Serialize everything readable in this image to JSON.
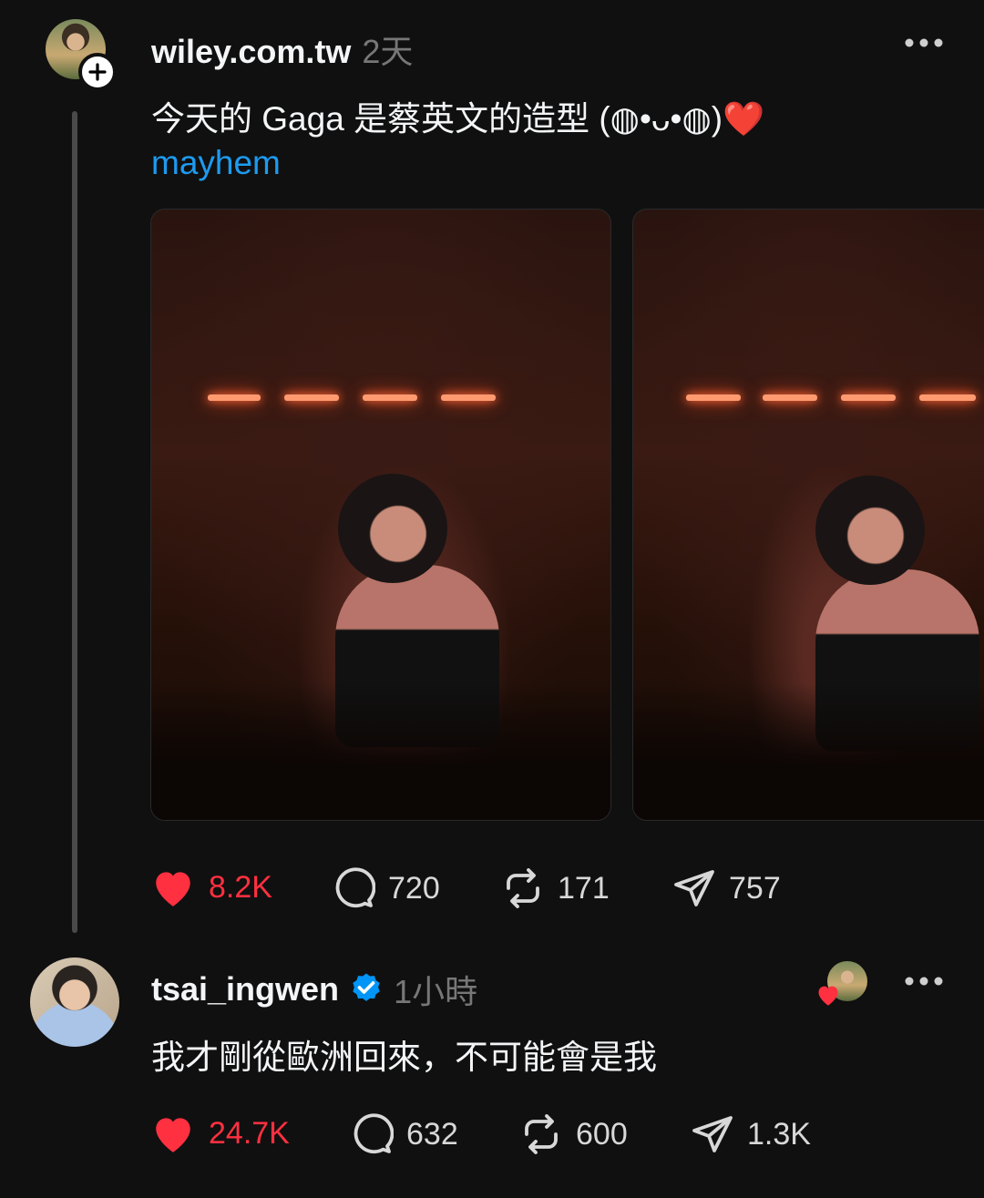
{
  "post1": {
    "username": "wiley.com.tw",
    "time": "2天",
    "text": "今天的 Gaga 是蔡英文的造型 (◍•ᴗ•◍)❤️",
    "tag": "mayhem",
    "actions": {
      "likes": "8.2K",
      "replies": "720",
      "reposts": "171",
      "shares": "757"
    }
  },
  "post2": {
    "username": "tsai_ingwen",
    "time": "1小時",
    "text": "我才剛從歐洲回來，不可能會是我",
    "actions": {
      "likes": "24.7K",
      "replies": "632",
      "reposts": "600",
      "shares": "1.3K"
    }
  },
  "colors": {
    "background": "#101010",
    "like": "#ff3040",
    "link": "#1d9bf0",
    "verified": "#0095f6"
  }
}
